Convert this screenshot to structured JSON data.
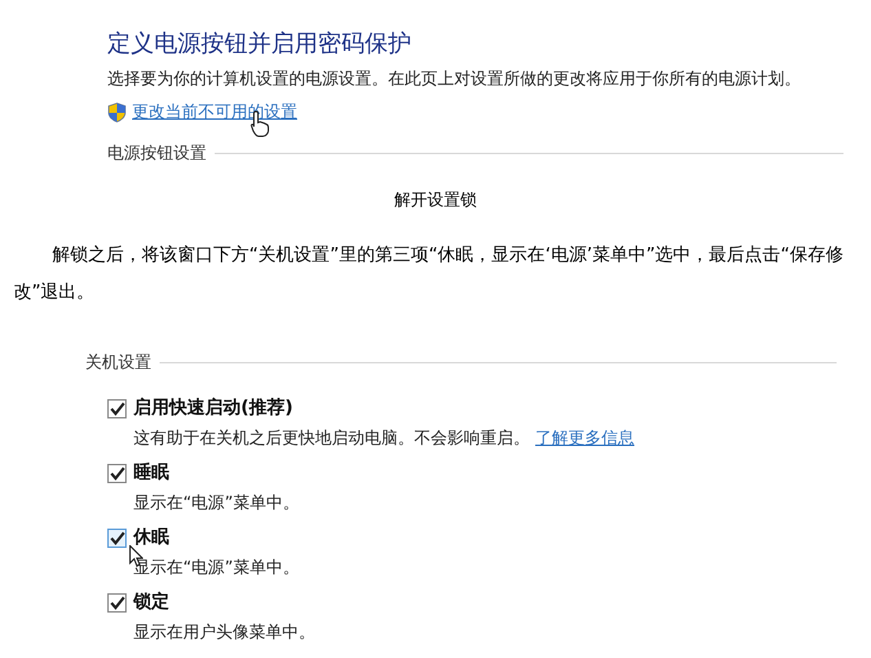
{
  "power_settings": {
    "title": "定义电源按钮并启用密码保护",
    "description": "选择要为你的计算机设置的电源设置。在此页上对设置所做的更改将应用于你所有的电源计划。",
    "link": "更改当前不可用的设置",
    "section": "电源按钮设置"
  },
  "caption": "解开设置锁",
  "paragraph": "解锁之后，将该窗口下方“关机设置”里的第三项“休眠，显示在‘电源’菜单中”选中，最后点击“保存修改”退出。",
  "shutdown_settings": {
    "heading": "关机设置",
    "items": [
      {
        "label": "启用快速启动(推荐)",
        "description": "这有助于在关机之后更快地启动电脑。不会影响重启。",
        "link": "了解更多信息",
        "checked": true
      },
      {
        "label": "睡眠",
        "description": "显示在“电源”菜单中。",
        "checked": true
      },
      {
        "label": "休眠",
        "description": "显示在“电源”菜单中。",
        "checked": true,
        "hovered": true
      },
      {
        "label": "锁定",
        "description": "显示在用户头像菜单中。",
        "checked": true
      }
    ]
  }
}
